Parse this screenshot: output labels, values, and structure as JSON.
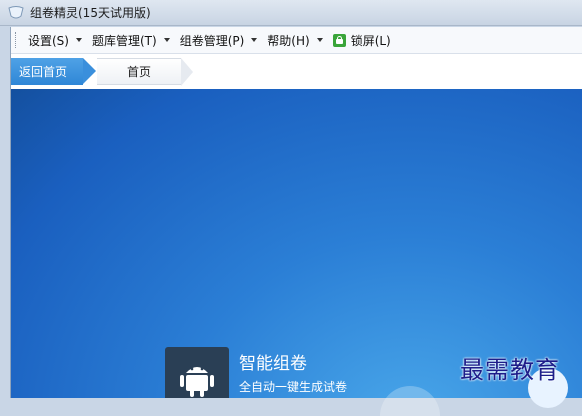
{
  "window": {
    "title": "组卷精灵(15天试用版)"
  },
  "menu": [
    {
      "label": "设置(S)"
    },
    {
      "label": "题库管理(T)"
    },
    {
      "label": "组卷管理(P)"
    },
    {
      "label": "帮助(H)"
    }
  ],
  "lock": {
    "label": "锁屏(L)"
  },
  "tabs": {
    "back": "返回首页",
    "home": "首页"
  },
  "feature": {
    "title": "智能组卷",
    "subtitle": "全自动一键生成试卷"
  },
  "watermark": "最需教育",
  "colors": {
    "accent": "#2f86d6",
    "content_bg": "#1a5fbf"
  }
}
